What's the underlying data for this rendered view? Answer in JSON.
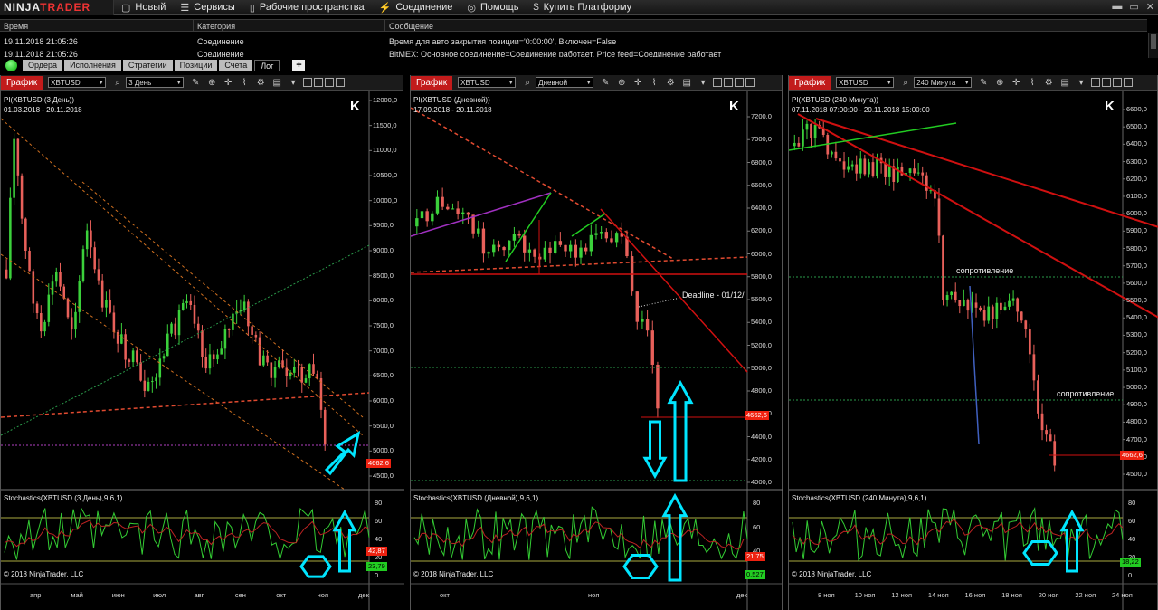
{
  "menubar": {
    "logo_a": "NINJA",
    "logo_b": "TRADER",
    "items": [
      {
        "icon": "▢",
        "label": "Новый"
      },
      {
        "icon": "☰",
        "label": "Сервисы"
      },
      {
        "icon": "▯",
        "label": "Рабочие пространства"
      },
      {
        "icon": "⚡",
        "label": "Соединение"
      },
      {
        "icon": "◎",
        "label": "Помощь"
      },
      {
        "icon": "$",
        "label": "Купить Платформу"
      }
    ],
    "window_controls": [
      "▬",
      "▭",
      "✕"
    ]
  },
  "log": {
    "headers": [
      "Время",
      "Категория",
      "Сообщение"
    ],
    "rows": [
      {
        "time": "19.11.2018 21:05:26",
        "category": "Соединение",
        "message": "Время для авто закрытия позиции='0:00:00', Включен=False"
      },
      {
        "time": "19.11.2018 21:05:26",
        "category": "Соединение",
        "message": "BitMEX: Основное соединение=Соединение работает, Price feed=Соединение работает"
      }
    ]
  },
  "tabs": [
    "Ордера",
    "Исполнения",
    "Стратегии",
    "Позиции",
    "Счета",
    "Лог"
  ],
  "tab_add": "+",
  "charts": [
    {
      "button": "График",
      "symbol": "XBTUSD",
      "interval": "3 День",
      "title": "PI(XBTUSD (3 День))",
      "range": "01.03.2018 - 20.11.2018",
      "prices": [
        "12000,0",
        "11500,0",
        "11000,0",
        "10500,0",
        "10000,0",
        "9500,0",
        "9000,0",
        "8500,0",
        "8000,0",
        "7500,0",
        "7000,0",
        "6500,0",
        "6000,0",
        "5500,0",
        "5000,0",
        "4500,0"
      ],
      "last_price": "4662,6",
      "indicator": "Stochastics(XBTUSD (3 День),9,6,1)",
      "osc_levels": [
        "80",
        "60",
        "40",
        "20",
        "0"
      ],
      "osc_tag_red": "42,87",
      "osc_tag_green": "23,79",
      "copyright": "© 2018 NinjaTrader, LLC",
      "x_labels": [
        "апр",
        "май",
        "июн",
        "июл",
        "авг",
        "сен",
        "окт",
        "ноя",
        "дек"
      ]
    },
    {
      "button": "График",
      "symbol": "XBTUSD",
      "interval": "Дневной",
      "title": "PI(XBTUSD (Дневной))",
      "range": "17.09.2018 - 20.11.2018",
      "prices": [
        "7200,0",
        "7000,0",
        "6800,0",
        "6600,0",
        "6400,0",
        "6200,0",
        "6000,0",
        "5800,0",
        "5600,0",
        "5400,0",
        "5200,0",
        "5000,0",
        "4800,0",
        "4600,0",
        "4400,0",
        "4200,0",
        "4000,0"
      ],
      "last_price": "4662,6",
      "annotation": "Deadline - 01/12/",
      "indicator": "Stochastics(XBTUSD (Дневной),9,6,1)",
      "osc_levels": [
        "80",
        "60",
        "40",
        "20"
      ],
      "osc_tag_red": "21,75",
      "osc_tag_green": "0,527",
      "copyright": "© 2018 NinjaTrader, LLC",
      "x_labels": [
        "окт",
        "ноя",
        "дек"
      ]
    },
    {
      "button": "График",
      "symbol": "XBTUSD",
      "interval": "240 Минута",
      "title": "PI(XBTUSD (240 Минута))",
      "range": "07.11.2018 07:00:00 - 20.11.2018 15:00:00",
      "prices": [
        "6600,0",
        "6500,0",
        "6400,0",
        "6300,0",
        "6200,0",
        "6100,0",
        "6000,0",
        "5900,0",
        "5800,0",
        "5700,0",
        "5600,0",
        "5500,0",
        "5400,0",
        "5300,0",
        "5200,0",
        "5100,0",
        "5000,0",
        "4900,0",
        "4800,0",
        "4700,0",
        "4600,0",
        "4500,0"
      ],
      "last_price": "4662,6",
      "annotation_1": "сопротивление",
      "annotation_2": "сопротивление",
      "indicator": "Stochastics(XBTUSD (240 Минута),9,6,1)",
      "osc_levels": [
        "80",
        "60",
        "40",
        "20",
        "0"
      ],
      "osc_tag_green": "18,22",
      "copyright": "© 2018 NinjaTrader, LLC",
      "x_labels": [
        "8 ноя",
        "10 ноя",
        "12 ноя",
        "14 ноя",
        "16 ноя",
        "18 ноя",
        "20 ноя",
        "22 ноя",
        "24 ноя"
      ]
    }
  ],
  "colors": {
    "accent_red": "#c21b1b",
    "bull": "#3bd13b",
    "bear": "#e8605a",
    "arrow": "#00e5ff"
  }
}
